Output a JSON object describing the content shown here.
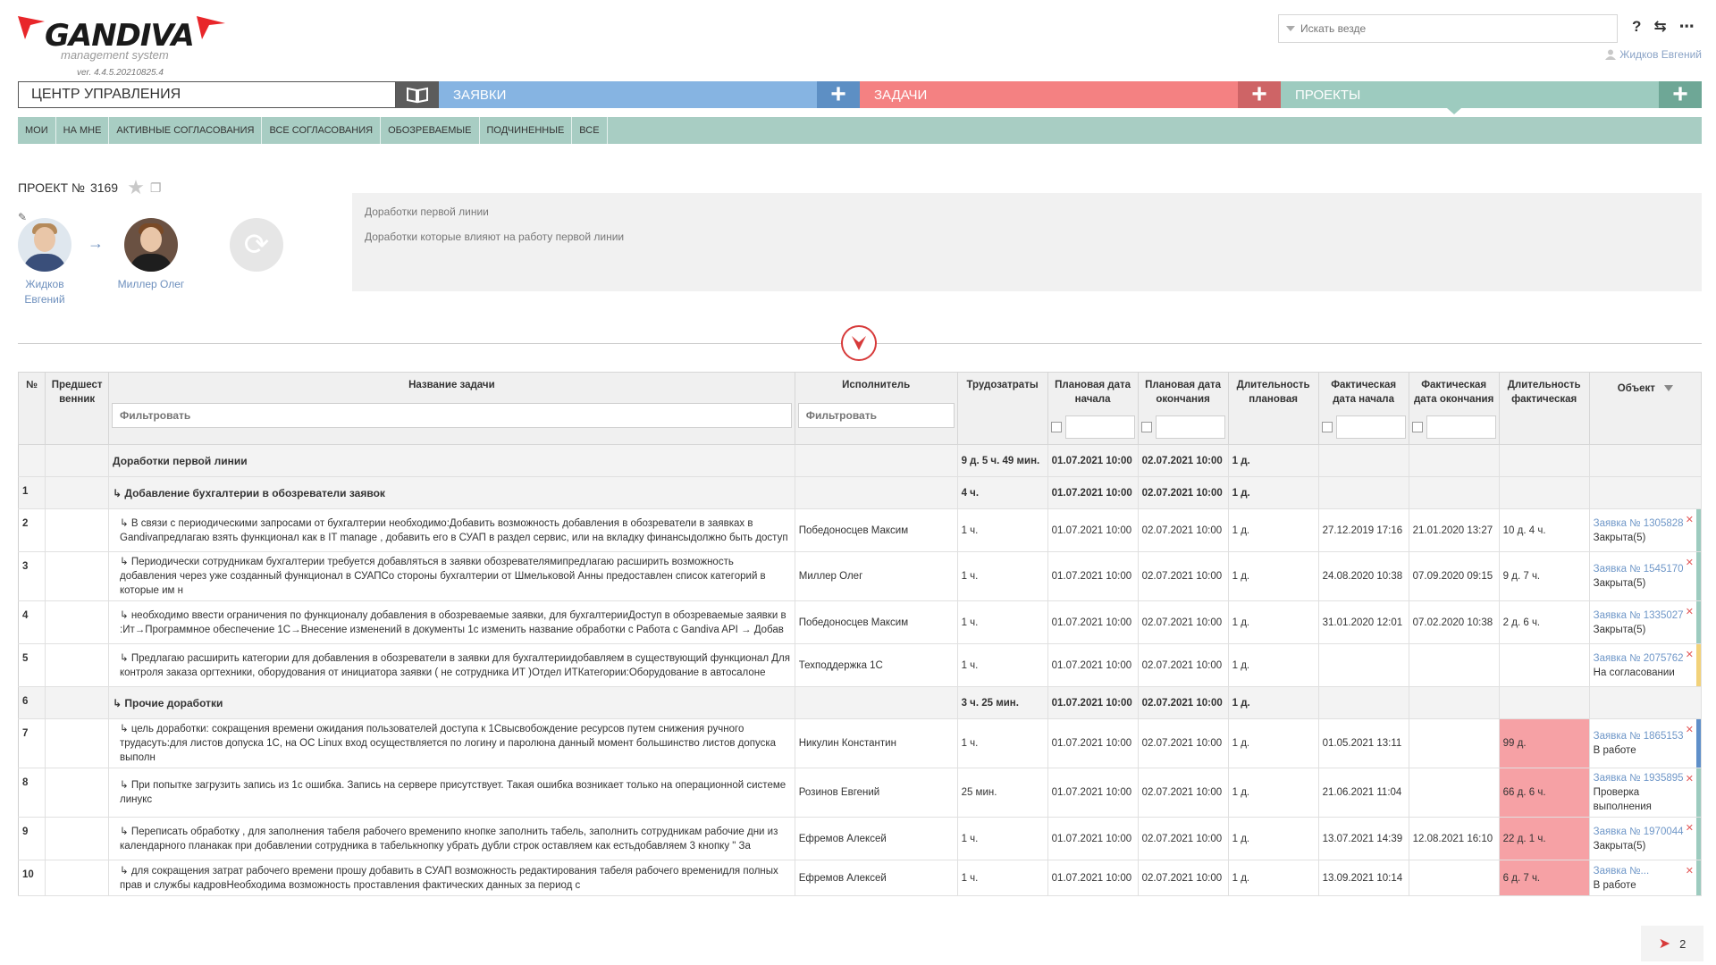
{
  "app": {
    "logo_text": "GANDIVA",
    "logo_sub": "management system",
    "version": "ver. 4.4.5.20210825.4"
  },
  "search": {
    "placeholder": "Искать везде"
  },
  "top_icons": [
    "help-icon",
    "switch-icon",
    "more-icon"
  ],
  "top_icon_glyphs": [
    "?",
    "⇆",
    "⋯"
  ],
  "user": {
    "name": "Жидков Евгений"
  },
  "nav": {
    "control_center": "ЦЕНТР УПРАВЛЕНИЯ",
    "requests": "ЗАЯВКИ",
    "tasks": "ЗАДАЧИ",
    "projects": "ПРОЕКТЫ",
    "plus": "+"
  },
  "colors": {
    "requests": "#86b4e2",
    "tasks": "#f48182",
    "projects": "#9dcbbf",
    "subnav": "#a8cdc3",
    "overdue": "#f6a1a5"
  },
  "subnav": [
    "МОИ",
    "НА МНЕ",
    "АКТИВНЫЕ СОГЛАСОВАНИЯ",
    "ВСЕ СОГЛАСОВАНИЯ",
    "ОБОЗРЕВАЕМЫЕ",
    "ПОДЧИНЕННЫЕ",
    "ВСЕ"
  ],
  "project": {
    "title_prefix": "ПРОЕКТ №",
    "number": "3169",
    "author": "Жидков Евгений",
    "executor": "Миллер Олег",
    "description_title": "Доработки первой линии",
    "description_text": "Доработки которые влияют на работу первой линии"
  },
  "table": {
    "headers": {
      "num": "№",
      "pred": "Предшественник",
      "name": "Название задачи",
      "executor": "Исполнитель",
      "effort": "Трудозатраты",
      "plan_start": "Плановая дата начала",
      "plan_end": "Плановая дата окончания",
      "dur_plan": "Длительность плановая",
      "fact_start": "Фактическая дата начала",
      "fact_end": "Фактическая дата окончания",
      "dur_fact": "Длительность фактическая",
      "object": "Объект"
    },
    "filter_placeholder": "Фильтровать",
    "rows": [
      {
        "num": "",
        "pred": "",
        "name": "Доработки первой линии",
        "exec": "",
        "effort": "9 д. 5 ч. 49 мин.",
        "ps": "01.07.2021 10:00",
        "pe": "02.07.2021 10:00",
        "dp": "1 д.",
        "fs": "",
        "fe": "",
        "df": "",
        "obj_link": "",
        "obj_status": "",
        "group": true
      },
      {
        "num": "1",
        "pred": "",
        "name": "↳ Добавление бухгалтерии в обозреватели заявок",
        "exec": "",
        "effort": "4 ч.",
        "ps": "01.07.2021 10:00",
        "pe": "02.07.2021 10:00",
        "dp": "1 д.",
        "fs": "",
        "fe": "",
        "df": "",
        "obj_link": "",
        "obj_status": "",
        "group": true
      },
      {
        "num": "2",
        "pred": "",
        "name": "↳ В связи с периодическими запросами от бухгалтерии необходимо:Добавить возможность добавления в обозреватели в заявках в Gandivaпредлагаю взять функционал как в IT manage , добавить его в СУАП в раздел сервис, или на вкладку финансыдолжно быть доступ",
        "exec": "Победоносцев Максим",
        "effort": "1 ч.",
        "ps": "01.07.2021 10:00",
        "pe": "02.07.2021 10:00",
        "dp": "1 д.",
        "fs": "27.12.2019 17:16",
        "fe": "21.01.2020 13:27",
        "df": "10 д. 4 ч.",
        "obj_link": "Заявка № 1305828",
        "obj_status": "Закрыта(5)",
        "bar": "#9dcbbf"
      },
      {
        "num": "3",
        "pred": "",
        "name": "↳ Периодически сотрудникам бухгалтерии  требуется добавляться в заявки обозревателямипредлагаю расширить возможность добавления через уже созданный функционал в СУАПСо стороны бухгалтерии от Шмельковой Анны предоставлен список категорий в которые им н",
        "exec": "Миллер Олег",
        "effort": "1 ч.",
        "ps": "01.07.2021 10:00",
        "pe": "02.07.2021 10:00",
        "dp": "1 д.",
        "fs": "24.08.2020 10:38",
        "fe": "07.09.2020 09:15",
        "df": "9 д. 7 ч.",
        "obj_link": "Заявка № 1545170",
        "obj_status": "Закрыта(5)",
        "bar": "#9dcbbf"
      },
      {
        "num": "4",
        "pred": "",
        "name": "↳ необходимо ввести ограничения по функционалу добавления в обозреваемые заявки, для бухгалтерииДоступ в обозреваемые заявки в :Ит→Программное обеспечение 1С→Внесение изменений в документы 1с изменить название обработки с Работа с Gandiva API → Добав",
        "exec": "Победоносцев Максим",
        "effort": "1 ч.",
        "ps": "01.07.2021 10:00",
        "pe": "02.07.2021 10:00",
        "dp": "1 д.",
        "fs": "31.01.2020 12:01",
        "fe": "07.02.2020 10:38",
        "df": "2 д. 6 ч.",
        "obj_link": "Заявка № 1335027",
        "obj_status": "Закрыта(5)",
        "bar": "#9dcbbf"
      },
      {
        "num": "5",
        "pred": "",
        "name": "↳ Предлагаю расширить категории для добавления в обозреватели в заявки для бухгалтериидобавляем в существующий функционал Для контроля заказа оргтехники, оборудования от инициатора заявки ( не сотрудника ИТ )Отдел ИТКатегории:Оборудование в автосалоне",
        "exec": "Техподдержка 1С",
        "effort": "1 ч.",
        "ps": "01.07.2021 10:00",
        "pe": "02.07.2021 10:00",
        "dp": "1 д.",
        "fs": "",
        "fe": "",
        "df": "",
        "obj_link": "Заявка № 2075762",
        "obj_status": "На согласовании",
        "bar": "#f2d27a"
      },
      {
        "num": "6",
        "pred": "",
        "name": "↳ Прочие доработки",
        "exec": "",
        "effort": "3 ч. 25 мин.",
        "ps": "01.07.2021 10:00",
        "pe": "02.07.2021 10:00",
        "dp": "1 д.",
        "fs": "",
        "fe": "",
        "df": "",
        "obj_link": "",
        "obj_status": "",
        "group": true
      },
      {
        "num": "7",
        "pred": "",
        "name": "↳ цель доработки: сокращения времени ожидания пользователей доступа к 1Свысвобождение ресурсов путем снижения ручного трудасуть:для листов допуска 1С, на ОС Linux вход осуществляется по логину и паролюна данный момент большинство листов допуска выполн",
        "exec": "Никулин Константин",
        "effort": "1 ч.",
        "ps": "01.07.2021 10:00",
        "pe": "02.07.2021 10:00",
        "dp": "1 д.",
        "fs": "01.05.2021 13:11",
        "fe": "",
        "df": "99 д.",
        "obj_link": "Заявка № 1865153",
        "obj_status": "В работе",
        "bar": "#5f8fc9",
        "overdue": true
      },
      {
        "num": "8",
        "pred": "",
        "name": "↳ При попытке загрузить запись из 1с ошибка. Запись на сервере присутствует. Такая ошибка возникает только на операционной системе линукс",
        "exec": "Розинов Евгений",
        "effort": "25 мин.",
        "ps": "01.07.2021 10:00",
        "pe": "02.07.2021 10:00",
        "dp": "1 д.",
        "fs": "21.06.2021 11:04",
        "fe": "",
        "df": "66 д. 6 ч.",
        "obj_link": "Заявка № 1935895",
        "obj_status": "Проверка выполнения",
        "bar": "#9dcbbf",
        "overdue": true
      },
      {
        "num": "9",
        "pred": "",
        "name": "↳ Переписать обработку , для заполнения табеля рабочего временипо кнопке заполнить табель, заполнить сотрудникам рабочие дни из календарного планакак при добавлении сотрудника в табелькнопку убрать дубли строк оставляем как естьдобавляем 3 кнопку \" За",
        "exec": "Ефремов Алексей",
        "effort": "1 ч.",
        "ps": "01.07.2021 10:00",
        "pe": "02.07.2021 10:00",
        "dp": "1 д.",
        "fs": "13.07.2021 14:39",
        "fe": "12.08.2021 16:10",
        "df": "22 д. 1 ч.",
        "obj_link": "Заявка № 1970044",
        "obj_status": "Закрыта(5)",
        "bar": "#9dcbbf",
        "overdue": true
      },
      {
        "num": "10",
        "pred": "",
        "name": "↳ для сокращения затрат рабочего времени прошу добавить в СУАП возможность редактирования табеля рабочего временидля полных прав и службы кадровНеобходима возможность проставления фактических данных за период с",
        "exec": "Ефремов Алексей",
        "effort": "1 ч.",
        "ps": "01.07.2021 10:00",
        "pe": "02.07.2021 10:00",
        "dp": "1 д.",
        "fs": "13.09.2021 10:14",
        "fe": "",
        "df": "6 д. 7 ч.",
        "obj_link": "Заявка №...",
        "obj_status": "В работе",
        "bar": "#9dcbbf",
        "overdue": true
      }
    ]
  },
  "pager": {
    "page": "2"
  }
}
